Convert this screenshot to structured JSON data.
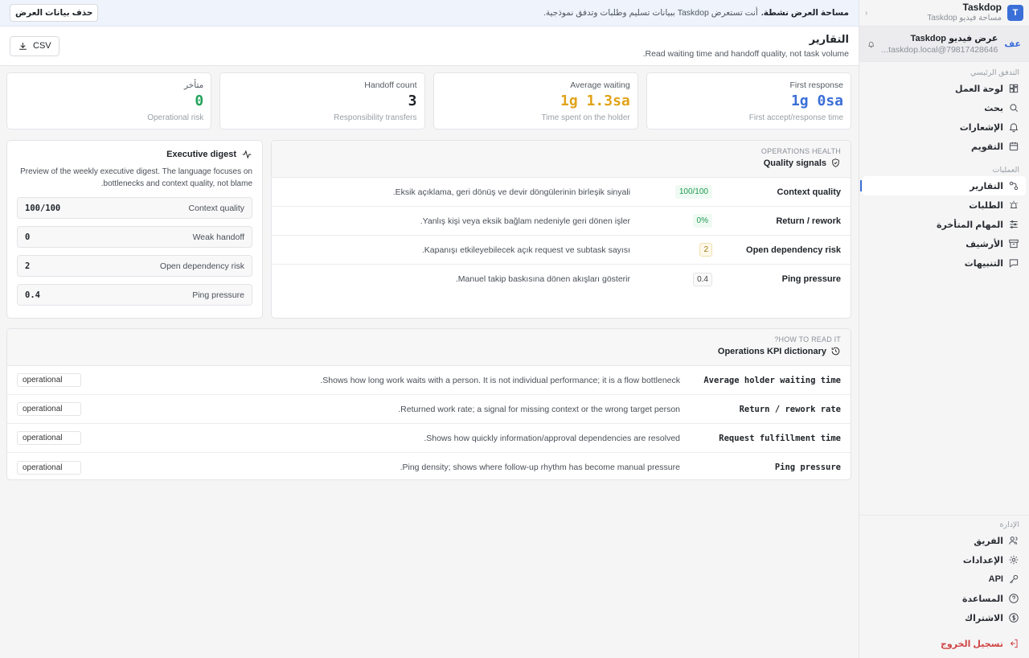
{
  "brand": {
    "name": "Taskdop",
    "subtitle": "مساحة فيديو Taskdop",
    "logo_letter": "T"
  },
  "user": {
    "avatar": "عف",
    "name": "عرض فيديو Taskdop",
    "email": "79817428646@taskdop.local..."
  },
  "nav": {
    "main_section": "التدفق الرئيسي",
    "main_items": [
      {
        "label": "لوحة العمل",
        "icon": "dashboard-icon"
      },
      {
        "label": "بحث",
        "icon": "search-icon"
      },
      {
        "label": "الإشعارات",
        "icon": "bell-icon"
      },
      {
        "label": "التقويم",
        "icon": "calendar-icon"
      }
    ],
    "ops_section": "العمليات",
    "ops_items": [
      {
        "label": "التقارير",
        "icon": "reports-icon",
        "active": true
      },
      {
        "label": "الطلبات",
        "icon": "alarm-icon"
      },
      {
        "label": "المهام المتأخرة",
        "icon": "sliders-icon"
      },
      {
        "label": "الأرشيف",
        "icon": "archive-icon"
      },
      {
        "label": "التنبيهات",
        "icon": "chat-icon"
      }
    ],
    "admin_section": "الإدارة",
    "admin_items": [
      {
        "label": "الفريق",
        "icon": "team-icon"
      },
      {
        "label": "الإعدادات",
        "icon": "gear-icon"
      },
      {
        "label": "API",
        "icon": "key-icon"
      },
      {
        "label": "المساعدة",
        "icon": "help-icon"
      },
      {
        "label": "الاشتراك",
        "icon": "dollar-icon"
      }
    ],
    "logout": "تسجيل الخروج"
  },
  "banner": {
    "title": "مساحة العرض نشطة.",
    "text": "أنت تستعرض Taskdop ببيانات تسليم وطلبات وتدفق نموذجية.",
    "delete_button": "حذف بيانات العرض"
  },
  "header": {
    "title": "التقارير",
    "subtitle": "Read waiting time and handoff quality, not task volume.",
    "csv_button": "CSV"
  },
  "kpis": [
    {
      "label": "First response",
      "value": "1g 0sa",
      "sub": "First accept/response time",
      "color": "#3b6fd8"
    },
    {
      "label": "Average waiting",
      "value": "1g 1.3sa",
      "sub": "Time spent on the holder",
      "color": "#e0a319"
    },
    {
      "label": "Handoff count",
      "value": "3",
      "sub": "Responsibility transfers",
      "color": "#1f2328"
    },
    {
      "label": "متأخر",
      "value": "0",
      "sub": "Operational risk",
      "color": "#22a35a"
    }
  ],
  "quality": {
    "eyebrow": "OPERATIONS HEALTH",
    "title": "Quality signals",
    "rows": [
      {
        "name": "Context quality",
        "value": "100/100",
        "desc": "Eksik açıklama, geri dönüş ve devir döngülerinin birleşik sinyali.",
        "tone": "green"
      },
      {
        "name": "Return / rework",
        "value": "0%",
        "desc": "Yanlış kişi veya eksik bağlam nedeniyle geri dönen işler.",
        "tone": "green"
      },
      {
        "name": "Open dependency risk",
        "value": "2",
        "desc": "Kapanışı etkileyebilecek açık request ve subtask sayısı.",
        "tone": "yellow"
      },
      {
        "name": "Ping pressure",
        "value": "0.4",
        "desc": "Manuel takip baskısına dönen akışları gösterir.",
        "tone": "neutral"
      }
    ]
  },
  "digest": {
    "title": "Executive digest",
    "desc": "Preview of the weekly executive digest. The language focuses on bottlenecks and context quality, not blame.",
    "rows": [
      {
        "label": "Context quality",
        "value": "100/100"
      },
      {
        "label": "Weak handoff",
        "value": "0"
      },
      {
        "label": "Open dependency risk",
        "value": "2"
      },
      {
        "label": "Ping pressure",
        "value": "0.4"
      }
    ]
  },
  "dictionary": {
    "eyebrow": "HOW TO READ IT?",
    "title": "Operations KPI dictionary",
    "rows": [
      {
        "name": "Average holder waiting time",
        "desc": "Shows how long work waits with a person. It is not individual performance; it is a flow bottleneck.",
        "tag": "operational"
      },
      {
        "name": "Return / rework rate",
        "desc": "Returned work rate; a signal for missing context or the wrong target person.",
        "tag": "operational"
      },
      {
        "name": "Request fulfillment time",
        "desc": "Shows how quickly information/approval dependencies are resolved.",
        "tag": "operational"
      },
      {
        "name": "Ping pressure",
        "desc": "Ping density; shows where follow-up rhythm has become manual pressure.",
        "tag": "operational"
      }
    ]
  }
}
